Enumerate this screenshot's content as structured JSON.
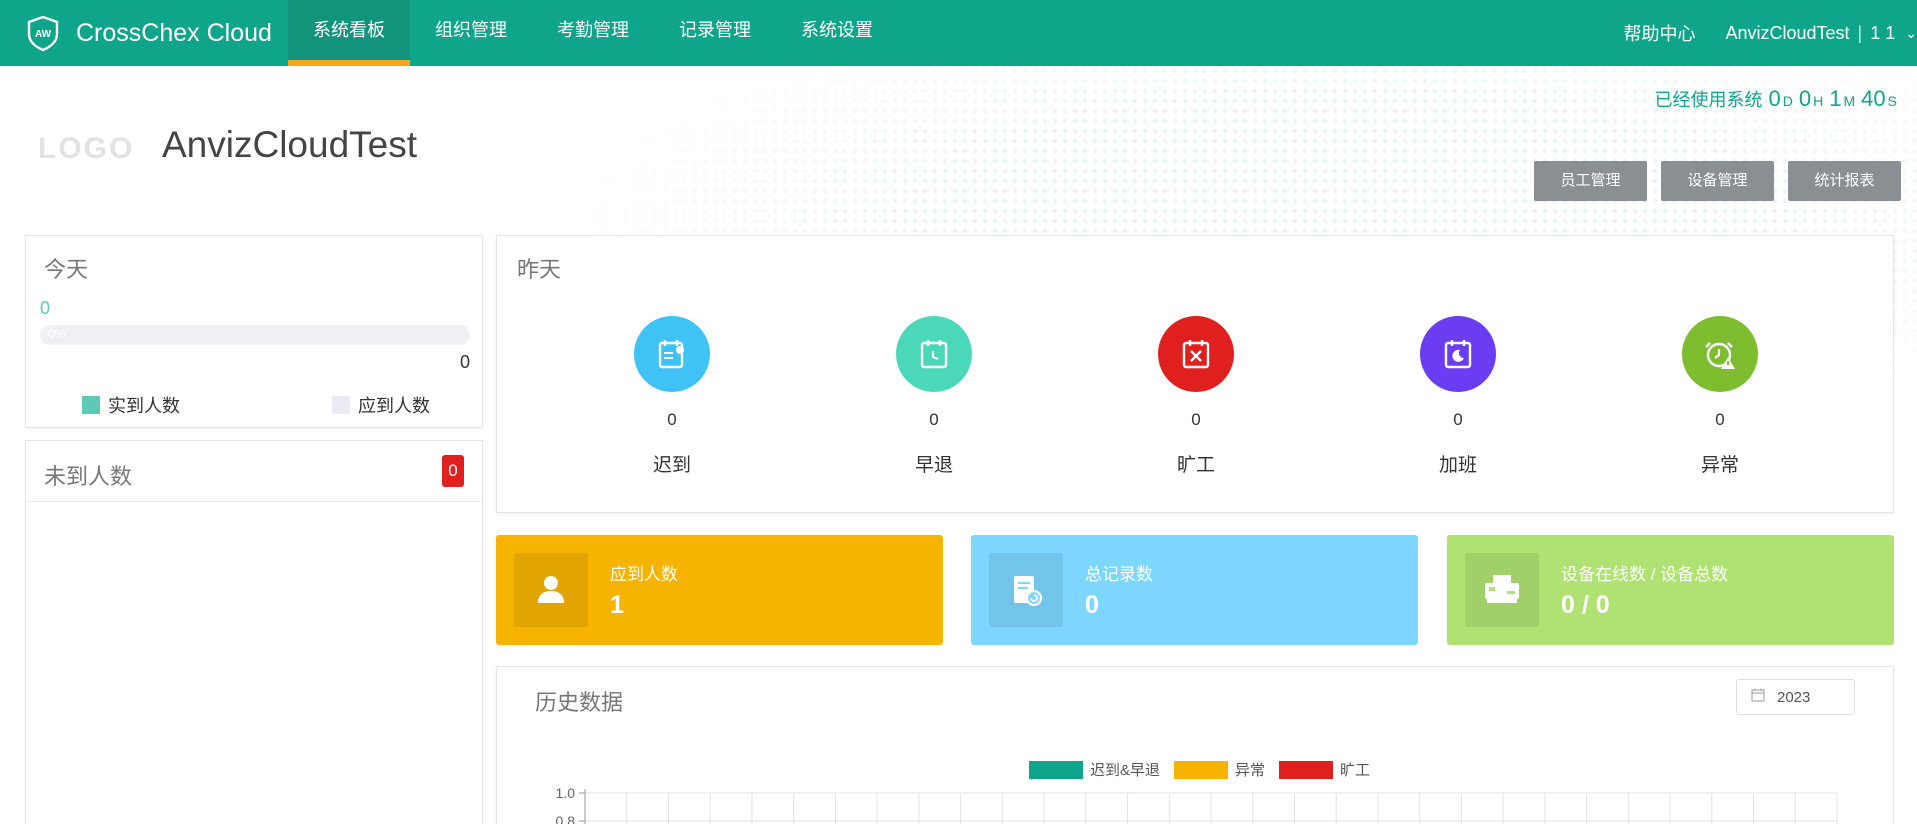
{
  "app": {
    "name": "CrossChex Cloud"
  },
  "nav": {
    "items": [
      {
        "label": "系统看板",
        "active": true
      },
      {
        "label": "组织管理"
      },
      {
        "label": "考勤管理"
      },
      {
        "label": "记录管理"
      },
      {
        "label": "系统设置"
      }
    ]
  },
  "header": {
    "help": "帮助中心",
    "user": "AnvizCloudTest",
    "user_sep": "|",
    "user_extra": "1 1",
    "chevron": "chevron-down-icon"
  },
  "uptime": {
    "prefix": "已经使用系统",
    "days": "0",
    "days_unit": "D",
    "hours": "0",
    "hours_unit": "H",
    "minutes": "1",
    "minutes_unit": "M",
    "seconds": "40",
    "seconds_unit": "S"
  },
  "company": {
    "logo_placeholder": "LOGO",
    "name": "AnvizCloudTest"
  },
  "quick_buttons": {
    "employees": "员工管理",
    "devices": "设备管理",
    "reports": "统计报表"
  },
  "today": {
    "title": "今天",
    "actual": "0",
    "progress_text": "0%",
    "progress": 0,
    "total": "0",
    "legend_actual": "实到人数",
    "legend_expected": "应到人数"
  },
  "absent": {
    "title": "未到人数",
    "count": "0"
  },
  "yesterday": {
    "title": "昨天",
    "items": [
      {
        "label": "迟到",
        "value": "0",
        "color": "#3fc3f7",
        "icon": "late-icon"
      },
      {
        "label": "早退",
        "value": "0",
        "color": "#4ad8b8",
        "icon": "early-leave-icon"
      },
      {
        "label": "旷工",
        "value": "0",
        "color": "#e0201f",
        "icon": "absence-icon"
      },
      {
        "label": "加班",
        "value": "0",
        "color": "#6a3cf2",
        "icon": "overtime-icon"
      },
      {
        "label": "异常",
        "value": "0",
        "color": "#7ebc30",
        "icon": "exception-icon"
      }
    ]
  },
  "tiles": [
    {
      "label": "应到人数",
      "value": "1",
      "color": "#f6b300",
      "icon": "person-icon"
    },
    {
      "label": "总记录数",
      "value": "0",
      "color": "#7cd6fd",
      "icon": "records-icon"
    },
    {
      "label": "设备在线数 / 设备总数",
      "value": "0 / 0",
      "color": "#afe273",
      "icon": "device-icon"
    }
  ],
  "history": {
    "title": "历史数据",
    "year": "2023"
  },
  "chart_data": {
    "type": "bar",
    "series": [
      {
        "name": "迟到&早退",
        "color": "#0fa58a"
      },
      {
        "name": "异常",
        "color": "#f6b300"
      },
      {
        "name": "旷工",
        "color": "#e0201f"
      }
    ],
    "y_tick_labels": [
      "1.0",
      "0.8"
    ],
    "ylim": [
      0,
      1.0
    ]
  },
  "colors": {
    "primary": "#0fa58a",
    "accent": "#f5a623",
    "legend_actual": "#5ec9b7",
    "legend_expected": "#e9ecf2"
  }
}
